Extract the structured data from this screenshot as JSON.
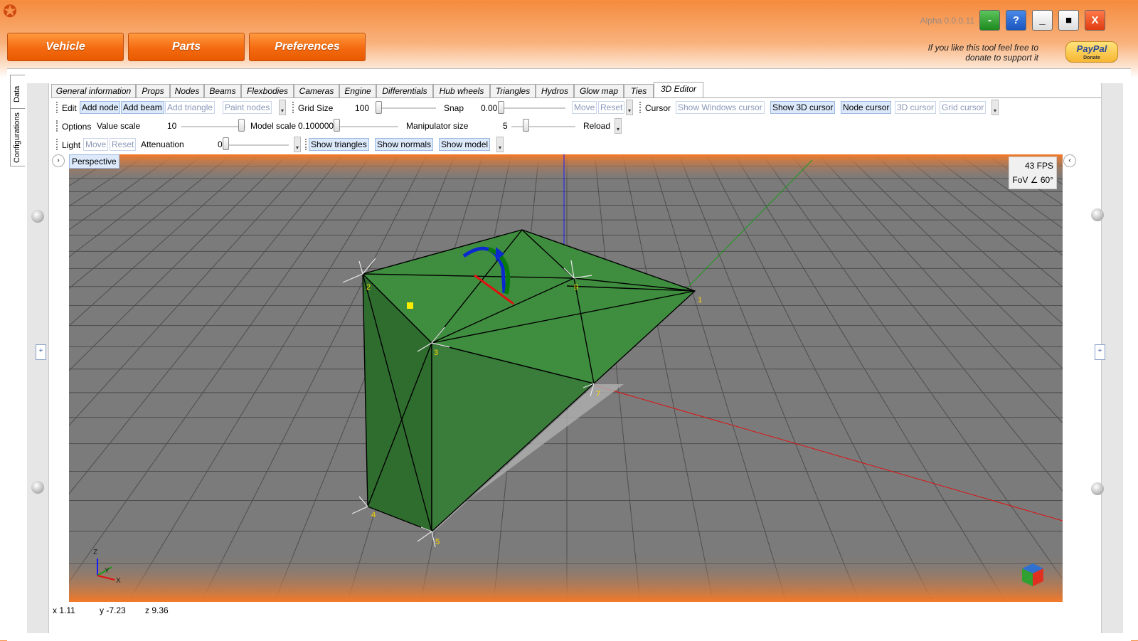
{
  "app": {
    "version": "Alpha 0.0.0.11",
    "logo_icon": "app-logo-icon"
  },
  "window_buttons": {
    "minimize_green": "-",
    "help": "?",
    "minimize": "_",
    "maximize": "■",
    "close": "X"
  },
  "main_nav": [
    "Vehicle",
    "Parts",
    "Preferences"
  ],
  "donate": {
    "line1": "If you like this tool feel free to",
    "line2": "donate to support it",
    "paypal": "PayPal",
    "paypal_sub": "Donate"
  },
  "side_tabs": [
    "Data",
    "Configurations"
  ],
  "tabs": [
    "General information",
    "Props",
    "Nodes",
    "Beams",
    "Flexbodies",
    "Cameras",
    "Engine",
    "Differentials",
    "Hub wheels",
    "Triangles",
    "Hydros",
    "Glow map",
    "Ties",
    "3D Editor"
  ],
  "active_tab": "3D Editor",
  "toolbar_edit": {
    "label": "Edit",
    "add_node": "Add node",
    "add_beam": "Add beam",
    "add_triangle": "Add triangle",
    "paint_nodes": "Paint nodes"
  },
  "toolbar_grid": {
    "label": "Grid Size",
    "value": "100",
    "snap_label": "Snap",
    "snap_value": "0.00",
    "move": "Move",
    "reset": "Reset"
  },
  "toolbar_cursor": {
    "label": "Cursor",
    "show_windows": "Show Windows cursor",
    "show_3d": "Show 3D cursor",
    "node_cursor": "Node cursor",
    "cursor_3d": "3D cursor",
    "grid_cursor": "Grid cursor"
  },
  "toolbar_options": {
    "label": "Options",
    "value_scale": "Value scale",
    "value_scale_val": "10",
    "model_scale": "Model scale",
    "model_scale_val": "0.100000",
    "manip_size": "Manipulator size",
    "manip_val": "5",
    "reload": "Reload"
  },
  "toolbar_light": {
    "label": "Light",
    "move": "Move",
    "reset": "Reset",
    "attenuation": "Attenuation",
    "atten_val": "0",
    "show_triangles": "Show triangles",
    "show_normals": "Show normals",
    "show_model": "Show model"
  },
  "viewport": {
    "mode": "Perspective",
    "fps": "43 FPS",
    "fov": "FoV ∠ 60°",
    "axis_z": "Z",
    "axis_y": "Y",
    "axis_x": "X",
    "node_labels": [
      "2",
      "9",
      "1",
      "3",
      "7",
      "4",
      "5"
    ]
  },
  "status": {
    "x": "x 1.11",
    "y": "y -7.23",
    "z": "z 9.36"
  },
  "colors": {
    "accent": "#f46a10",
    "green_mesh": "#3b8a3b",
    "grid_bg": "#7c7c7c"
  }
}
